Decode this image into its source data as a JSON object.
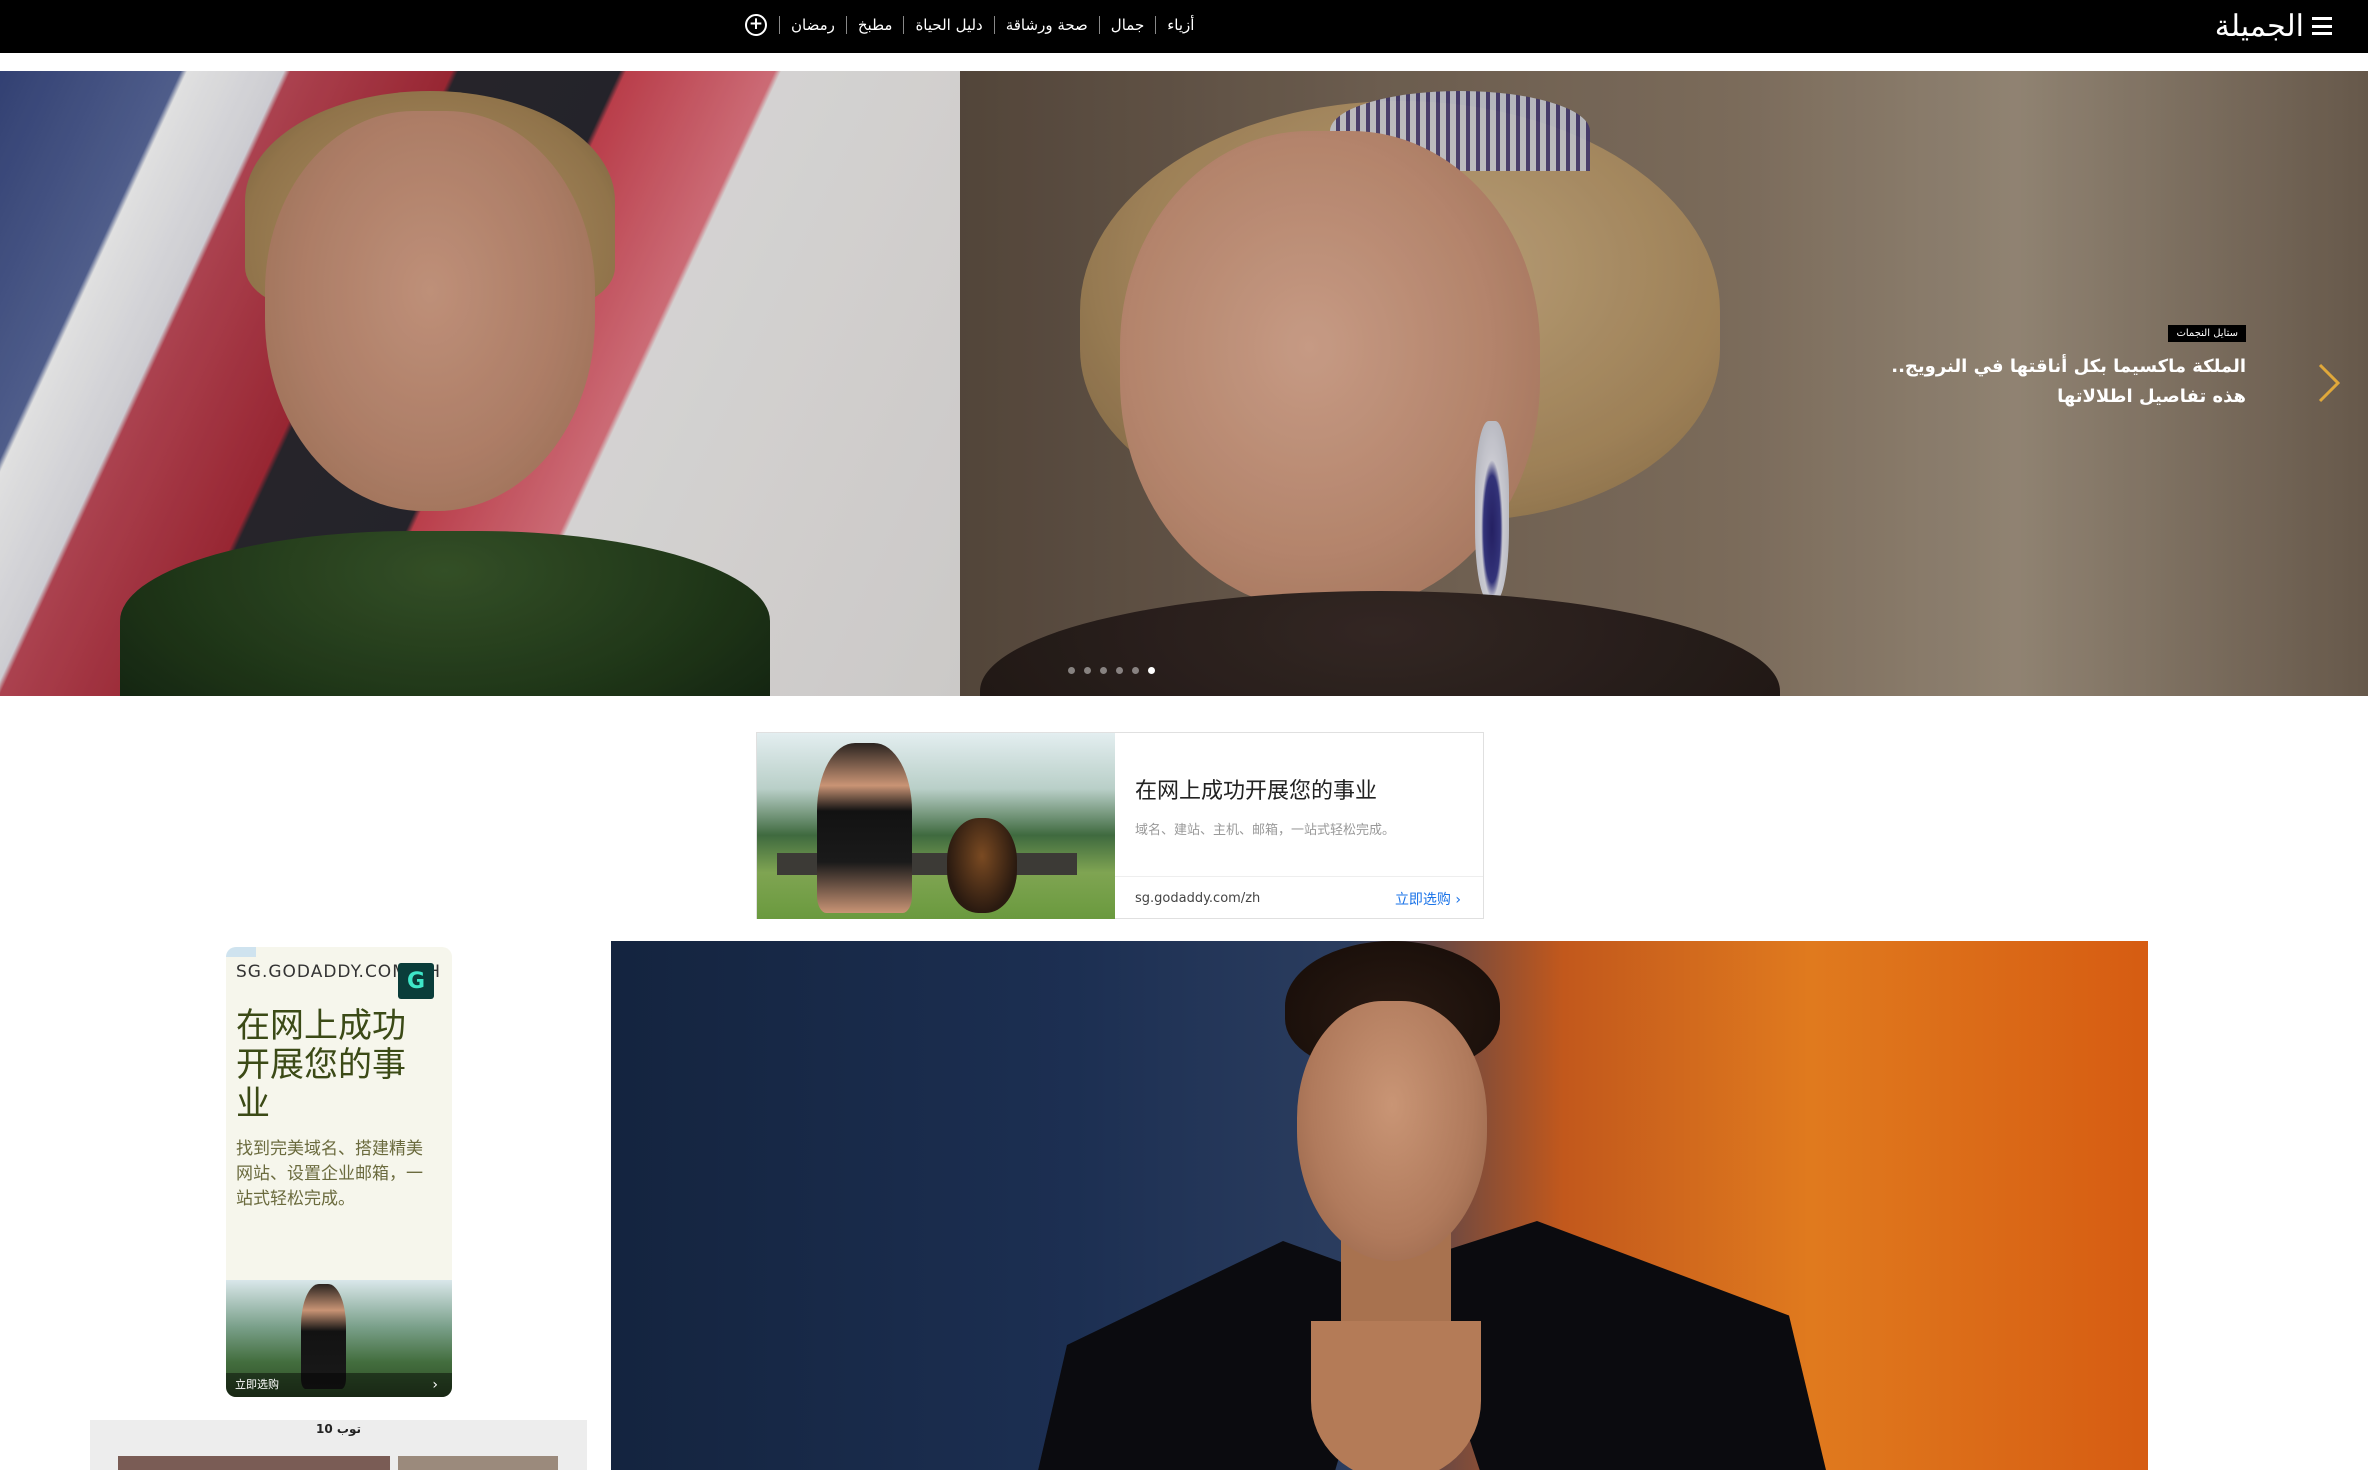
{
  "header": {
    "logo_text": "الجميلة",
    "menu_icon": "hamburger-menu-icon",
    "nav": [
      "أزياء",
      "جمال",
      "صحة ورشاقة",
      "دليل الحياة",
      "مطبخ",
      "رمضان"
    ],
    "more_icon": "plus-circle-icon"
  },
  "hero": {
    "tag": "ستايل النجمات",
    "title_line1": "الملكة ماكسيما بكل أناقتها في النرويج..",
    "title_line2": "هذه تفاصيل اطلالاتها",
    "next_icon": "chevron-right-icon",
    "slide_count": 6,
    "active_slide": 6
  },
  "ad_banner": {
    "title": "在网上成功开展您的事业",
    "subtitle": "域名、建站、主机、邮箱，一站式轻松完成。",
    "domain": "sg.godaddy.com/zh",
    "cta": "立即选购 ›"
  },
  "ad_vertical": {
    "domain": "SG.GODADDY.COM/ZH",
    "headline": "在网上成功开展您的事业",
    "body": "找到完美域名、搭建精美网站、设置企业邮箱，一站式轻松完成。",
    "cta": "立即选购",
    "logo_glyph": "G"
  },
  "top10": {
    "title": "توب 10"
  },
  "colors": {
    "header_bg": "#000000",
    "accent_arrow": "#e0a83a",
    "cta_blue": "#1a73e8"
  }
}
